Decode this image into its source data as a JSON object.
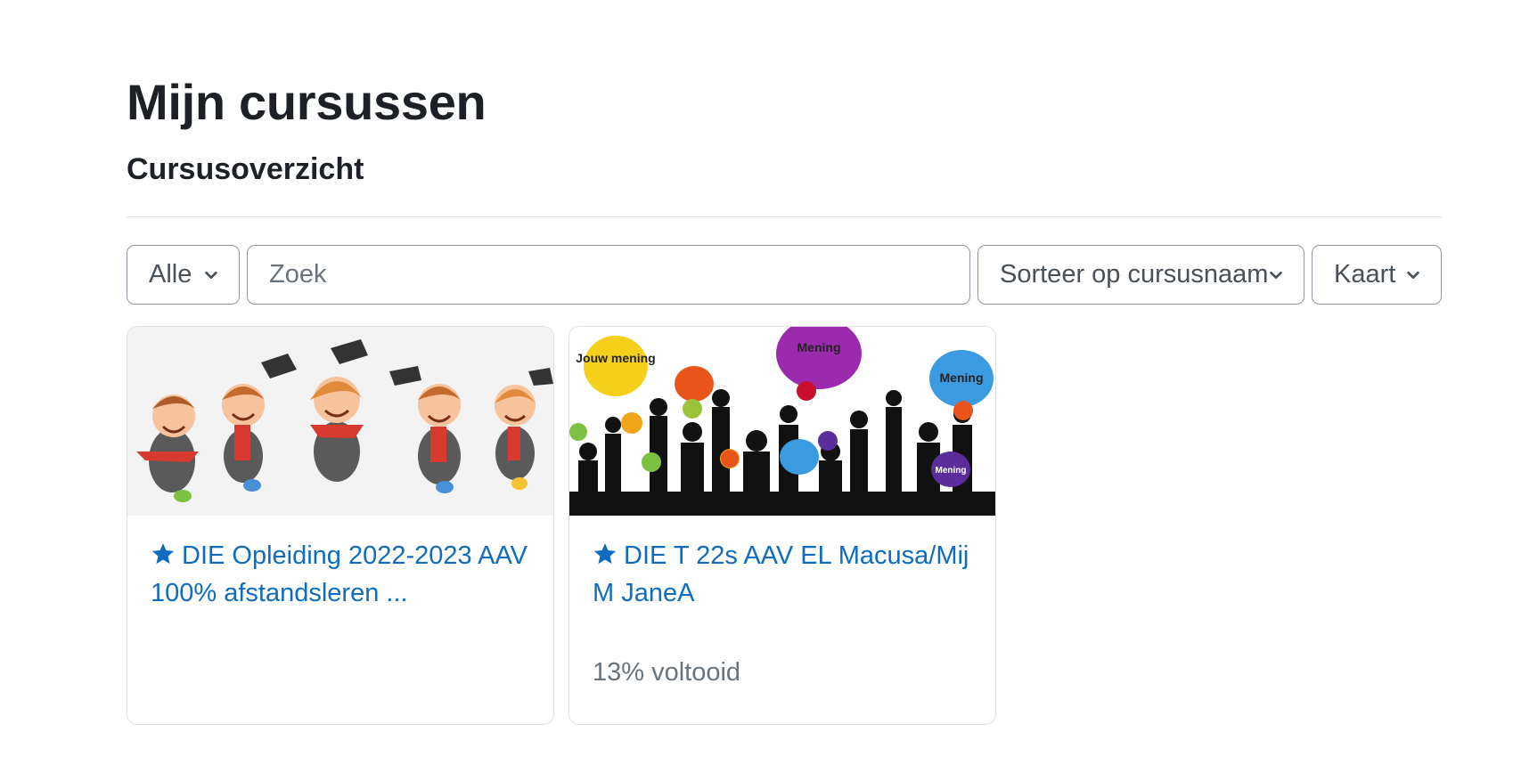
{
  "header": {
    "title": "Mijn cursussen",
    "subtitle": "Cursusoverzicht"
  },
  "filters": {
    "grouping": "Alle",
    "search_placeholder": "Zoek",
    "sort": "Sorteer op cursusnaam",
    "view": "Kaart"
  },
  "courses": [
    {
      "title": "DIE Opleiding 2022-2023 AAV 100% afstandsleren ...",
      "progress": "",
      "starred": true,
      "image": "graduating-kids-illustration"
    },
    {
      "title": "DIE T 22s AAV EL Macusa/Mij M JaneA",
      "progress": "13% voltooid",
      "progress_value": 13,
      "starred": true,
      "image": "opinion-speech-bubbles-silhouettes",
      "bubbles": [
        "Jouw mening",
        "Mening",
        "Mening",
        "Mening"
      ]
    }
  ],
  "colors": {
    "link": "#0f6cbf",
    "text": "#1d2125",
    "muted": "#6a737b",
    "border": "#8f959e"
  }
}
